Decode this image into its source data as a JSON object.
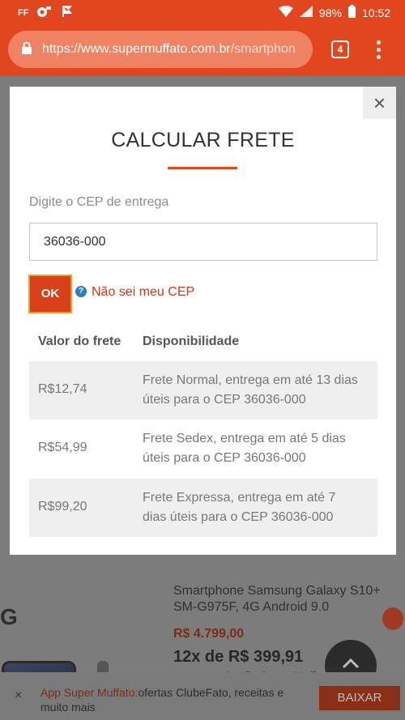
{
  "status_bar": {
    "left_icons": [
      "ff-icon",
      "wheel-icon",
      "flag-icon"
    ],
    "left_label": "FF",
    "battery": "98%",
    "time": "10:52"
  },
  "browser": {
    "url_host": "https://www.supermuffato.com.br",
    "url_path": "/smartphon",
    "tab_count": "4"
  },
  "modal": {
    "title": "CALCULAR FRETE",
    "cep_label": "Digite o CEP de entrega",
    "cep_value": "36036-000",
    "ok_label": "OK",
    "help_icon": "?",
    "help_link": "Não sei meu CEP",
    "table": {
      "headers": [
        "Valor do frete",
        "Disponibilidade"
      ],
      "rows": [
        {
          "price": "R$12,74",
          "desc": "Frete Normal, entrega em até 13 dias úteis para o CEP 36036-000"
        },
        {
          "price": "R$54,99",
          "desc": "Frete Sedex, entrega em até 5 dias úteis para o CEP 36036-000"
        },
        {
          "price": "R$99,20",
          "desc": "Frete Expressa, entrega em até 7 dias úteis para o CEP 36036-000"
        }
      ]
    },
    "close_symbol": "×"
  },
  "background": {
    "section_letter": "G",
    "product_name": "Smartphone Samsung Galaxy S10+ SM-G975F, 4G Android 9.0",
    "price": "R$ 4.799,00",
    "installment": "12x de R$ 399,91",
    "cut_text": "...Cartão Super Muffato"
  },
  "app_banner": {
    "close_symbol": "×",
    "brand": "App Super Muffato:",
    "text": "ofertas ClubeFato, receitas e muito mais",
    "button": "BAIXAR"
  }
}
